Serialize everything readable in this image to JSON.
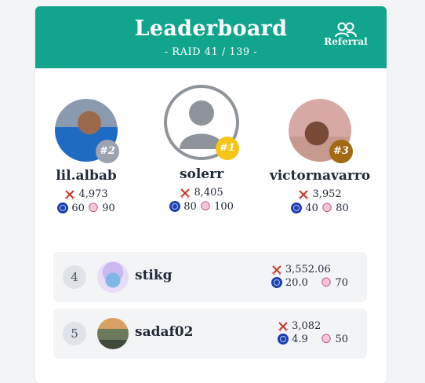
{
  "header": {
    "title": "Leaderboard",
    "subtitle": "- RAID 41 / 139 -",
    "referral_label": "Referral"
  },
  "colors": {
    "header_bg": "#12a58e",
    "rank1": "#f5c518",
    "rank2": "#9ca3af",
    "rank3": "#a36a12"
  },
  "podium": [
    {
      "rank_label": "#2",
      "name": "lil.albab",
      "damage": "4,973",
      "sp": "60",
      "mascot": "90"
    },
    {
      "rank_label": "#1",
      "name": "solerr",
      "damage": "8,405",
      "sp": "80",
      "mascot": "100"
    },
    {
      "rank_label": "#3",
      "name": "victornavarro",
      "damage": "3,952",
      "sp": "40",
      "mascot": "80"
    }
  ],
  "rows": [
    {
      "rank": "4",
      "name": "stikg",
      "damage": "3,552.06",
      "sp": "20.0",
      "mascot": "70"
    },
    {
      "rank": "5",
      "name": "sadaf02",
      "damage": "3,082",
      "sp": "4.9",
      "mascot": "50"
    }
  ],
  "icons": {
    "referral": "users-icon",
    "damage": "crossed-swords-icon",
    "sp": "steem-coin-icon",
    "mascot": "mascot-icon"
  }
}
